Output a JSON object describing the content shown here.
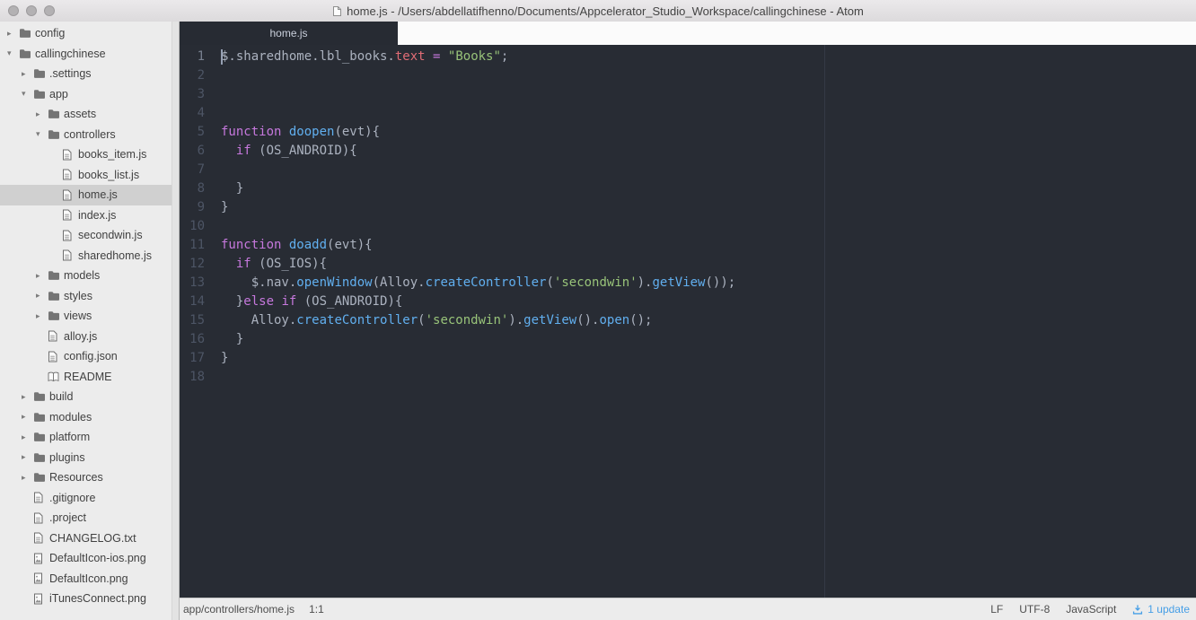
{
  "window": {
    "title": "home.js - /Users/abdellatifhenno/Documents/Appcelerator_Studio_Workspace/callingchinese - Atom"
  },
  "tabs": [
    {
      "label": "home.js",
      "active": true
    }
  ],
  "tree": {
    "items": [
      {
        "label": "config",
        "depth": 0,
        "type": "folder",
        "expanded": false
      },
      {
        "label": "callingchinese",
        "depth": 0,
        "type": "folder",
        "expanded": true
      },
      {
        "label": ".settings",
        "depth": 1,
        "type": "folder",
        "expanded": false
      },
      {
        "label": "app",
        "depth": 1,
        "type": "folder",
        "expanded": true
      },
      {
        "label": "assets",
        "depth": 2,
        "type": "folder",
        "expanded": false
      },
      {
        "label": "controllers",
        "depth": 2,
        "type": "folder",
        "expanded": true
      },
      {
        "label": "books_item.js",
        "depth": 3,
        "type": "file"
      },
      {
        "label": "books_list.js",
        "depth": 3,
        "type": "file"
      },
      {
        "label": "home.js",
        "depth": 3,
        "type": "file",
        "selected": true
      },
      {
        "label": "index.js",
        "depth": 3,
        "type": "file"
      },
      {
        "label": "secondwin.js",
        "depth": 3,
        "type": "file"
      },
      {
        "label": "sharedhome.js",
        "depth": 3,
        "type": "file"
      },
      {
        "label": "models",
        "depth": 2,
        "type": "folder",
        "expanded": false
      },
      {
        "label": "styles",
        "depth": 2,
        "type": "folder",
        "expanded": false
      },
      {
        "label": "views",
        "depth": 2,
        "type": "folder",
        "expanded": false
      },
      {
        "label": "alloy.js",
        "depth": 2,
        "type": "file"
      },
      {
        "label": "config.json",
        "depth": 2,
        "type": "file"
      },
      {
        "label": "README",
        "depth": 2,
        "type": "readme"
      },
      {
        "label": "build",
        "depth": 1,
        "type": "folder",
        "expanded": false
      },
      {
        "label": "modules",
        "depth": 1,
        "type": "folder",
        "expanded": false
      },
      {
        "label": "platform",
        "depth": 1,
        "type": "folder",
        "expanded": false
      },
      {
        "label": "plugins",
        "depth": 1,
        "type": "folder",
        "expanded": false
      },
      {
        "label": "Resources",
        "depth": 1,
        "type": "folder",
        "expanded": false
      },
      {
        "label": ".gitignore",
        "depth": 1,
        "type": "file"
      },
      {
        "label": ".project",
        "depth": 1,
        "type": "file"
      },
      {
        "label": "CHANGELOG.txt",
        "depth": 1,
        "type": "file"
      },
      {
        "label": "DefaultIcon-ios.png",
        "depth": 1,
        "type": "image"
      },
      {
        "label": "DefaultIcon.png",
        "depth": 1,
        "type": "image"
      },
      {
        "label": "iTunesConnect.png",
        "depth": 1,
        "type": "image"
      }
    ]
  },
  "editor": {
    "cursor": {
      "line": 1,
      "column": 1
    },
    "lines": [
      {
        "n": 1,
        "t": [
          [
            "$.sharedhome.lbl_books.",
            "plain"
          ],
          [
            "text",
            "property"
          ],
          [
            " ",
            "plain"
          ],
          [
            "=",
            "operator"
          ],
          [
            " ",
            "plain"
          ],
          [
            "\"Books\"",
            "string"
          ],
          [
            ";",
            "plain"
          ]
        ]
      },
      {
        "n": 2,
        "t": []
      },
      {
        "n": 3,
        "t": []
      },
      {
        "n": 4,
        "t": []
      },
      {
        "n": 5,
        "t": [
          [
            "function",
            "keyword"
          ],
          [
            " ",
            "plain"
          ],
          [
            "doopen",
            "function"
          ],
          [
            "(evt){",
            "plain"
          ]
        ]
      },
      {
        "n": 6,
        "t": [
          [
            "  ",
            "plain"
          ],
          [
            "if",
            "keyword"
          ],
          [
            " (OS_ANDROID){",
            "plain"
          ]
        ]
      },
      {
        "n": 7,
        "t": []
      },
      {
        "n": 8,
        "t": [
          [
            "  }",
            "plain"
          ]
        ]
      },
      {
        "n": 9,
        "t": [
          [
            "}",
            "plain"
          ]
        ]
      },
      {
        "n": 10,
        "t": []
      },
      {
        "n": 11,
        "t": [
          [
            "function",
            "keyword"
          ],
          [
            " ",
            "plain"
          ],
          [
            "doadd",
            "function"
          ],
          [
            "(evt){",
            "plain"
          ]
        ]
      },
      {
        "n": 12,
        "t": [
          [
            "  ",
            "plain"
          ],
          [
            "if",
            "keyword"
          ],
          [
            " (OS_IOS){",
            "plain"
          ]
        ]
      },
      {
        "n": 13,
        "t": [
          [
            "    $.nav.",
            "plain"
          ],
          [
            "openWindow",
            "function"
          ],
          [
            "(Alloy.",
            "plain"
          ],
          [
            "createController",
            "function"
          ],
          [
            "(",
            "plain"
          ],
          [
            "'secondwin'",
            "string"
          ],
          [
            ").",
            "plain"
          ],
          [
            "getView",
            "function"
          ],
          [
            "());",
            "plain"
          ]
        ]
      },
      {
        "n": 14,
        "t": [
          [
            "  }",
            "plain"
          ],
          [
            "else",
            "keyword"
          ],
          [
            " ",
            "plain"
          ],
          [
            "if",
            "keyword"
          ],
          [
            " (OS_ANDROID){",
            "plain"
          ]
        ]
      },
      {
        "n": 15,
        "t": [
          [
            "    Alloy.",
            "plain"
          ],
          [
            "createController",
            "function"
          ],
          [
            "(",
            "plain"
          ],
          [
            "'secondwin'",
            "string"
          ],
          [
            ").",
            "plain"
          ],
          [
            "getView",
            "function"
          ],
          [
            "().",
            "plain"
          ],
          [
            "open",
            "function"
          ],
          [
            "();",
            "plain"
          ]
        ]
      },
      {
        "n": 16,
        "t": [
          [
            "  }",
            "plain"
          ]
        ]
      },
      {
        "n": 17,
        "t": [
          [
            "}",
            "plain"
          ]
        ]
      },
      {
        "n": 18,
        "t": []
      }
    ]
  },
  "status_bar": {
    "path": "app/controllers/home.js",
    "cursor_position": "1:1",
    "line_ending": "LF",
    "encoding": "UTF-8",
    "language": "JavaScript",
    "update": "1 update"
  },
  "colors": {
    "plain": "#abb2bf",
    "keyword": "#c678dd",
    "function": "#61afef",
    "string": "#98c379",
    "property": "#e06c75",
    "operator": "#c678dd",
    "editor_bg": "#282c34",
    "update_accent": "#459ee6",
    "sidebar_bg": "#ececec",
    "selection_bg": "#d0d0d0"
  }
}
